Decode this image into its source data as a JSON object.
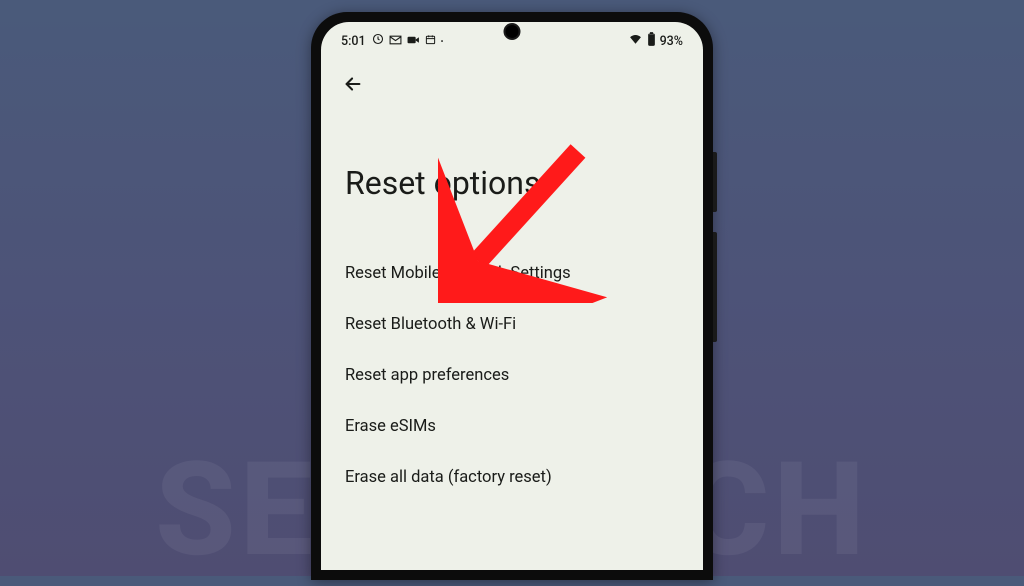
{
  "watermark": "SEEBITECH",
  "statusbar": {
    "time": "5:01",
    "battery": "93%"
  },
  "page": {
    "title": "Reset options"
  },
  "menu": {
    "items": [
      {
        "label": "Reset Mobile Network Settings"
      },
      {
        "label": "Reset Bluetooth & Wi-Fi"
      },
      {
        "label": "Reset app preferences"
      },
      {
        "label": "Erase eSIMs"
      },
      {
        "label": "Erase all data (factory reset)"
      }
    ]
  }
}
